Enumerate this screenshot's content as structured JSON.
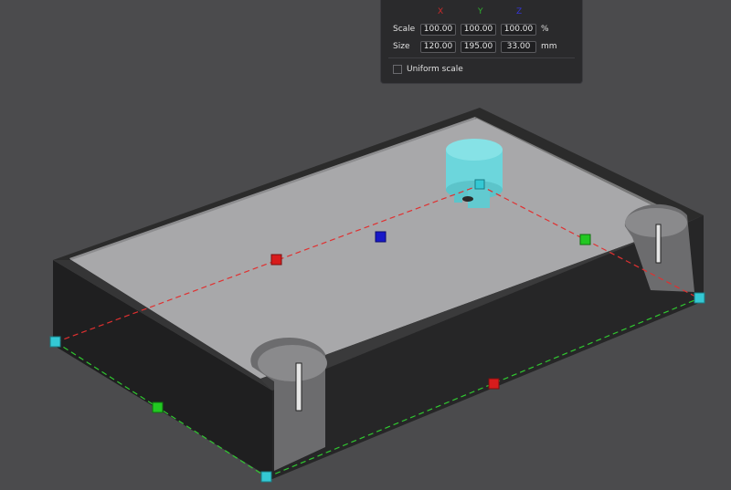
{
  "colors": {
    "background": "#4b4b4d",
    "axis_x": "#cc2a2a",
    "axis_y": "#2fb02f",
    "axis_z": "#2a2ad0",
    "handle_corner": "#34c8d4",
    "handle_x": "#d81c1c",
    "handle_y": "#22c822",
    "handle_z": "#1818c8",
    "selected_part": "#6cd6dc"
  },
  "panel": {
    "axes": {
      "x": "X",
      "y": "Y",
      "z": "Z"
    },
    "scale": {
      "label": "Scale",
      "x": "100.00",
      "y": "100.00",
      "z": "100.00",
      "unit": "%"
    },
    "size": {
      "label": "Size",
      "x": "120.00",
      "y": "195.00",
      "z": "33.00",
      "unit": "mm"
    },
    "uniform_scale": {
      "label": "Uniform scale",
      "checked": false
    }
  }
}
